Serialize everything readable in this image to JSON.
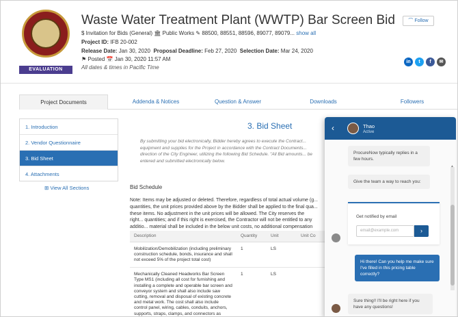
{
  "header": {
    "seal_badge": "EVALUATION",
    "title": "Waste Water Treatment Plant (WWTP) Bar Screen Bid",
    "categories_line": "$ Invitation for Bids (General)  🏛 Public Works  ✎ 88500, 88551, 88596, 89077, 89079...",
    "show_all": "show all",
    "project_id_label": "Project ID:",
    "project_id": "IFB 20-002",
    "release_label": "Release Date:",
    "release_date": "Jan 30, 2020",
    "proposal_label": "Proposal Deadline:",
    "proposal_date": "Feb 27, 2020",
    "selection_label": "Selection Date:",
    "selection_date": "Mar 24, 2020",
    "posted": "⚑ Posted  📅 Jan 30, 2020 11:57 AM",
    "timezone_note": "All dates & times in Pacific Time",
    "follow_label": "Follow",
    "social": [
      {
        "name": "in",
        "color": "#0a66c2"
      },
      {
        "name": "t",
        "color": "#1da1f2"
      },
      {
        "name": "f",
        "color": "#3b5998"
      },
      {
        "name": "✉",
        "color": "#555555"
      }
    ]
  },
  "tabs": [
    {
      "label": "Project Documents"
    },
    {
      "label": "Addenda & Notices"
    },
    {
      "label": "Question & Answer"
    },
    {
      "label": "Downloads"
    },
    {
      "label": "Followers"
    }
  ],
  "sidenav": {
    "items": [
      {
        "label": "1. Introduction"
      },
      {
        "label": "2. Vendor Questionnaire"
      },
      {
        "label": "3. Bid Sheet"
      },
      {
        "label": "4. Attachments"
      }
    ],
    "view_all": "⊞ View All Sections"
  },
  "main": {
    "section_title": "3. Bid Sheet",
    "intro": "By submitting your bid electronically, Bidder hereby agrees to execute the Contract... equipment and supplies for the Project in accordance with the Contract Documents... direction of the City Engineer, utilizing the following Bid Schedule. \"All Bid amounts... be entered and submitted electronically below.",
    "bid_schedule": "Bid Schedule",
    "note": "Note: Items may be adjusted or deleted. Therefore, regardless of total actual volume (g... quantities, the unit prices provided above by the Bidder shall be applied to the final qua... these items. No adjustment in the unit prices will be allowed. The City reserves the right... quantities; and if this right is exercised, the Contractor will not be entitled to any additio... material shall be included in the below unit costs, no additional compensation will be g...",
    "table": {
      "headers": [
        "Description",
        "Quantity",
        "Unit",
        "Unit Co"
      ],
      "rows": [
        {
          "description": "Mobilization/Demobilization (including preliminary construction schedule, bonds, insurance and shall not exceed 5% of the project total cost)",
          "quantity": "1",
          "unit": "LS",
          "unit_cost": ""
        },
        {
          "description": "Mechanically Cleaned Headworks Bar Screen Type MS1 (including all cost for furnishing and installing a complete and operable bar screen and conveyor system and shall also include saw cutting, removal and disposal of existing concrete and metal work. The cost shall also include control panel, wiring, cables, conduits, anchors, supports, straps, clamps, and connectors as required; connection to existing",
          "quantity": "1",
          "unit": "LS",
          "unit_cost": ""
        }
      ]
    }
  },
  "chat": {
    "agent_name": "Thao",
    "agent_status": "Active",
    "msg_reply_time": "ProcureNow typically replies in a few hours.",
    "msg_reach": "Give the team a way to reach you:",
    "notify_label": "Get notified by email",
    "email_placeholder": "email@example.com",
    "user_msg": "Hi there! Can you help me make sure I've filled in this pricing table correctly?",
    "agent_reply": "Sure thing!! I'll be right here if you have any questions!"
  }
}
